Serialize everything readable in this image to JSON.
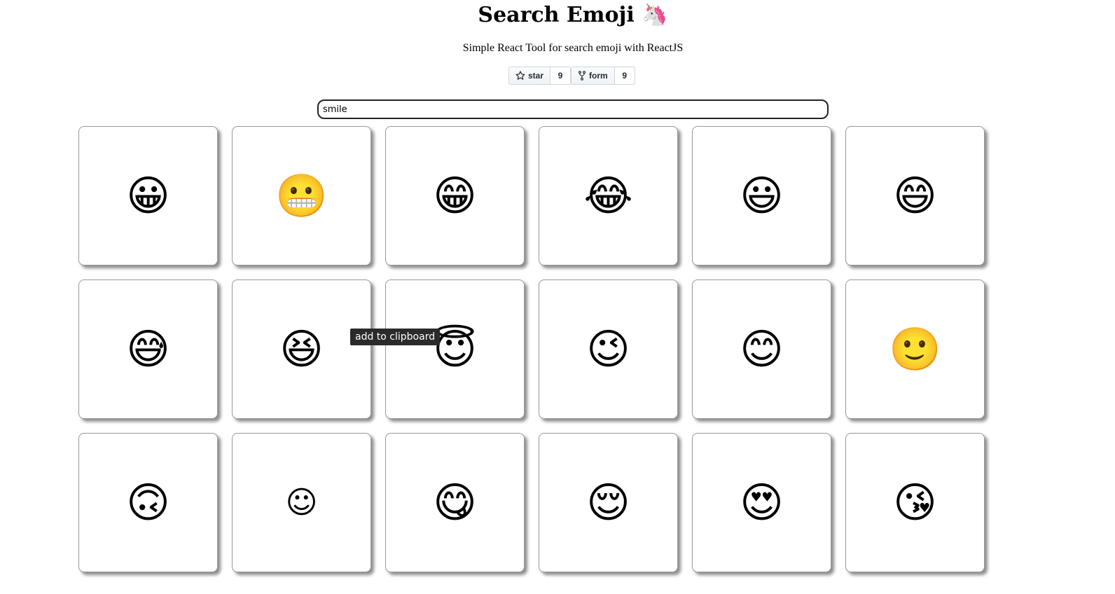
{
  "header": {
    "title": "Search Emoji 🦄",
    "subtitle": "Simple React Tool for search emoji with ReactJS"
  },
  "github": {
    "star_label": "star",
    "star_count": "9",
    "fork_label": "form",
    "fork_count": "9"
  },
  "search": {
    "value": "smile"
  },
  "tooltip": {
    "text": "add to clipboard"
  },
  "emojis": [
    {
      "symbol": "😀",
      "icon": "grinning-face-icon"
    },
    {
      "symbol": "😬",
      "icon": "grimacing-face-icon"
    },
    {
      "symbol": "😁",
      "icon": "beaming-face-icon"
    },
    {
      "symbol": "😂",
      "icon": "tears-of-joy-icon"
    },
    {
      "symbol": "😃",
      "icon": "grinning-big-eyes-icon"
    },
    {
      "symbol": "😄",
      "icon": "grinning-smiling-eyes-icon"
    },
    {
      "symbol": "😅",
      "icon": "grinning-sweat-icon"
    },
    {
      "symbol": "😆",
      "icon": "squinting-face-icon"
    },
    {
      "symbol": "😇",
      "icon": "halo-face-icon"
    },
    {
      "symbol": "😉",
      "icon": "winking-face-icon"
    },
    {
      "symbol": "😊",
      "icon": "smiling-eyes-icon"
    },
    {
      "symbol": "🙂",
      "icon": "slightly-smiling-icon"
    },
    {
      "symbol": "🙃",
      "icon": "upside-down-face-icon"
    },
    {
      "symbol": "☺",
      "icon": "smiling-face-outline-icon"
    },
    {
      "symbol": "😋",
      "icon": "savoring-food-icon"
    },
    {
      "symbol": "😌",
      "icon": "relieved-face-icon"
    },
    {
      "symbol": "😍",
      "icon": "heart-eyes-icon"
    },
    {
      "symbol": "😘",
      "icon": "blowing-kiss-icon"
    }
  ]
}
